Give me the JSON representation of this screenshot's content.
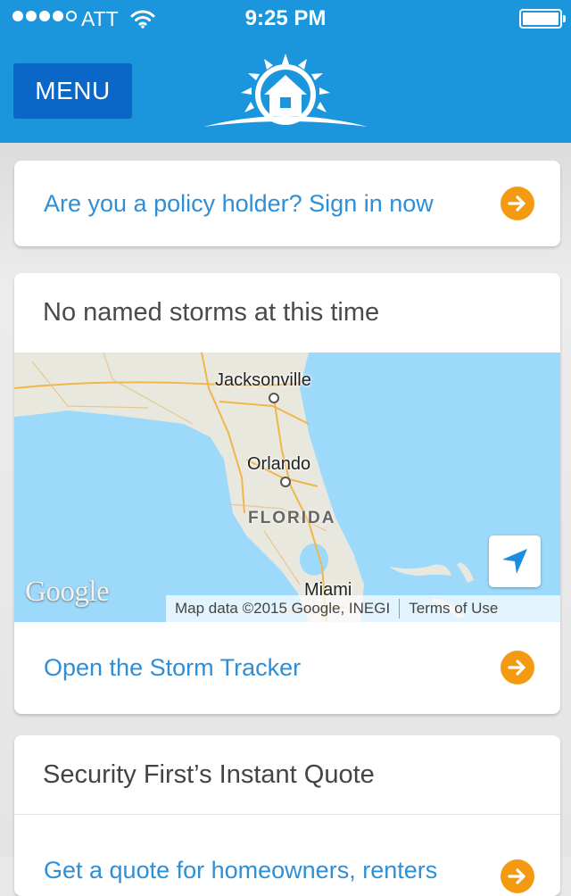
{
  "status_bar": {
    "carrier": "ATT",
    "time": "9:25 PM",
    "signal_bars_filled": 4,
    "signal_bars_total": 5,
    "icons": [
      "wifi-icon",
      "battery-icon"
    ]
  },
  "nav": {
    "menu_label": "MENU",
    "logo": "house-sun-logo"
  },
  "policy_card": {
    "link_text": "Are you a policy holder? Sign in now",
    "icon": "arrow-right-circle-icon"
  },
  "storm_card": {
    "title": "No named storms at this time",
    "map": {
      "cities": [
        "Jacksonville",
        "Orlando",
        "Miami"
      ],
      "state": "FLORIDA",
      "logo_text": "Google",
      "attribution": "Map data ©2015 Google, INEGI",
      "terms": "Terms of Use",
      "locate_icon": "navigation-arrow-icon"
    },
    "link_text": "Open the Storm Tracker",
    "icon": "arrow-right-circle-icon"
  },
  "quote_card": {
    "title": "Security First’s Instant Quote",
    "link_text": "Get a quote for homeowners, renters",
    "icon": "arrow-right-circle-icon"
  },
  "colors": {
    "header_blue": "#1b95dc",
    "menu_button_blue": "#0a67c8",
    "link_blue": "#2e8fd6",
    "arrow_orange": "#f39a12",
    "water": "#9dd9fa"
  }
}
